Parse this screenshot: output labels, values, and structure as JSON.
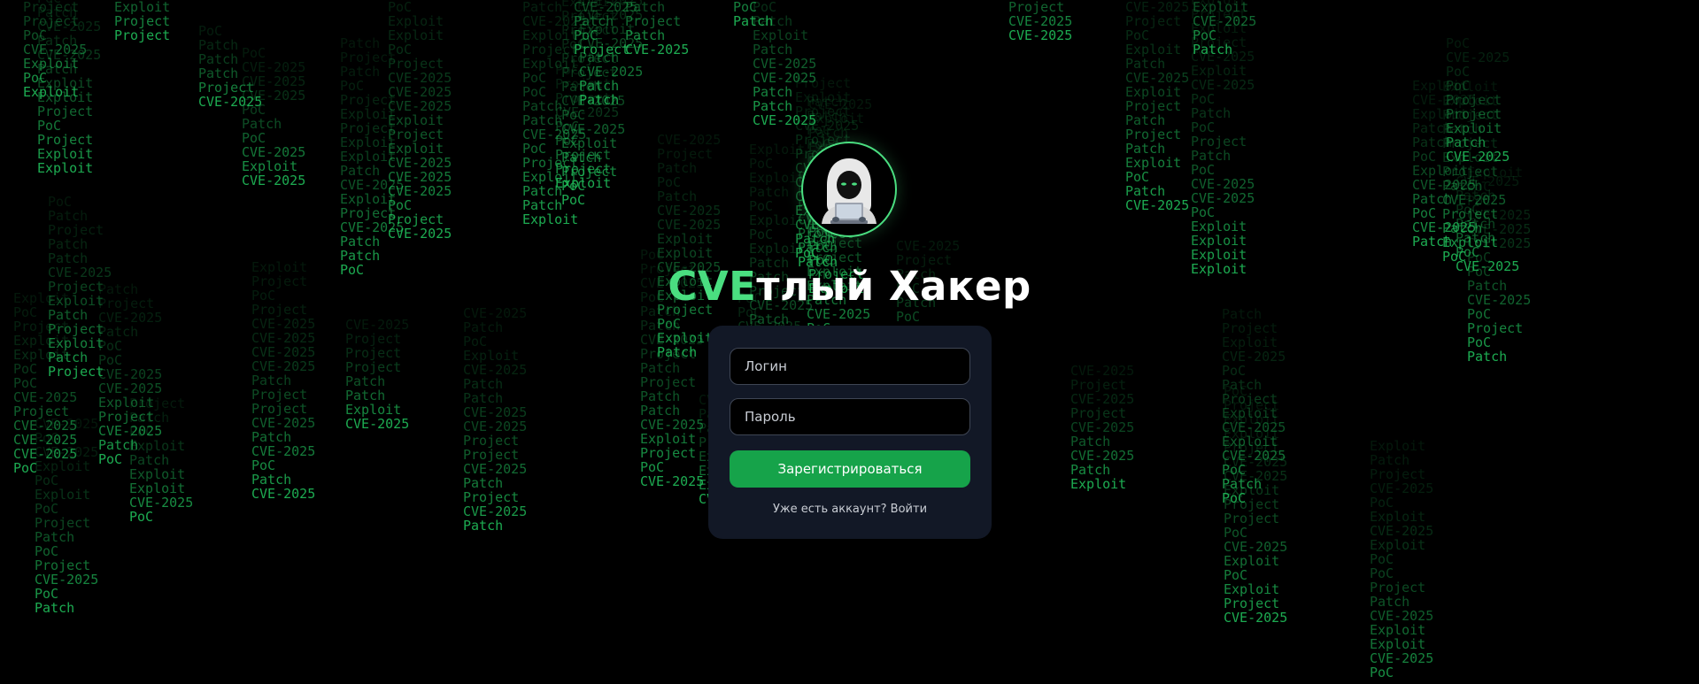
{
  "brand": {
    "title_accent": "CVE",
    "title_rest": "тлый Хакер",
    "accent_color": "#4ade80",
    "logo_icon": "hooded-hacker-icon"
  },
  "form": {
    "login_placeholder": "Логин",
    "password_placeholder": "Пароль",
    "submit_label": "Зарегистрироваться",
    "login_link": "Уже есть аккаунт? Войти",
    "button_color": "#16a34a",
    "card_color": "#121826"
  },
  "background": {
    "style": "matrix-rain",
    "color": "#22c55e",
    "words": [
      "CVE-2025",
      "PoC",
      "Patch",
      "Exploit",
      "Project"
    ]
  }
}
